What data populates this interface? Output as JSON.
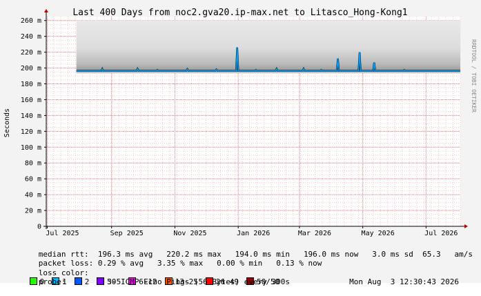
{
  "chart_data": {
    "type": "area",
    "title": "Last 400 Days from noc2.gva20.ip-max.net to Litasco_Hong-Kong1",
    "ylabel": "Seconds",
    "side_label": "RRDTOOL / TOBI OETIKER",
    "ylim": [
      0,
      0.265
    ],
    "y_ticks": [
      {
        "value": 0,
        "label": "0"
      },
      {
        "value": 0.02,
        "label": "20 m"
      },
      {
        "value": 0.04,
        "label": "40 m"
      },
      {
        "value": 0.06,
        "label": "60 m"
      },
      {
        "value": 0.08,
        "label": "80 m"
      },
      {
        "value": 0.1,
        "label": "100 m"
      },
      {
        "value": 0.12,
        "label": "120 m"
      },
      {
        "value": 0.14,
        "label": "140 m"
      },
      {
        "value": 0.16,
        "label": "160 m"
      },
      {
        "value": 0.18,
        "label": "180 m"
      },
      {
        "value": 0.2,
        "label": "200 m"
      },
      {
        "value": 0.22,
        "label": "220 m"
      },
      {
        "value": 0.24,
        "label": "240 m"
      },
      {
        "value": 0.26,
        "label": "260 m"
      }
    ],
    "x_range": [
      "2025-06-30",
      "2026-08-03"
    ],
    "data_start": "2025-07-29",
    "x_ticks": [
      {
        "date": "2025-07-01",
        "label": "Jul 2025"
      },
      {
        "date": "2025-09-01",
        "label": "Sep 2025"
      },
      {
        "date": "2025-11-01",
        "label": "Nov 2025"
      },
      {
        "date": "2026-01-01",
        "label": "Jan 2026"
      },
      {
        "date": "2026-03-01",
        "label": "Mar 2026"
      },
      {
        "date": "2026-05-01",
        "label": "May 2026"
      },
      {
        "date": "2026-07-01",
        "label": "Jul 2026"
      }
    ],
    "smoke_upper": 0.26,
    "median_baseline": 0.1963,
    "median_spikes": [
      {
        "date": "2025-08-23",
        "value": 0.199
      },
      {
        "date": "2025-09-26",
        "value": 0.199
      },
      {
        "date": "2025-10-15",
        "value": 0.1975
      },
      {
        "date": "2025-11-13",
        "value": 0.1985
      },
      {
        "date": "2025-12-11",
        "value": 0.198
      },
      {
        "date": "2025-12-31",
        "value": 0.226
      },
      {
        "date": "2026-01-18",
        "value": 0.1975
      },
      {
        "date": "2026-02-07",
        "value": 0.199
      },
      {
        "date": "2026-03-05",
        "value": 0.199
      },
      {
        "date": "2026-03-22",
        "value": 0.1975
      },
      {
        "date": "2026-04-07",
        "value": 0.212
      },
      {
        "date": "2026-04-28",
        "value": 0.22
      },
      {
        "date": "2026-05-12",
        "value": 0.207
      },
      {
        "date": "2026-06-10",
        "value": 0.1975
      }
    ],
    "colors": {
      "background": "#f3f3f3",
      "canvas": "#ffffff",
      "median": "#00a0ff",
      "median_outline": "#000000",
      "grid_minor": "#f0c8c8",
      "grid_major": "#e08080",
      "axis_arrow": "#c00000"
    }
  },
  "legend": {
    "median_rtt": {
      "label": "median rtt:",
      "avg": "196.3 ms avg",
      "max": "220.2 ms max",
      "min": "194.0 ms min",
      "now": "196.0 ms now",
      "sd": "3.0 ms sd",
      "am": "65.3   am/s"
    },
    "packet_loss": {
      "label": "packet loss:",
      "avg": "0.29 % avg",
      "max": "3.35 % max",
      "min": "0.00 % min",
      "now": "0.13 % now"
    },
    "loss_color": {
      "label": "loss color:",
      "items": [
        {
          "label": "0",
          "color": "#26ff00"
        },
        {
          "label": "1",
          "color": "#00b8ff"
        },
        {
          "label": "2",
          "color": "#0059ff"
        },
        {
          "label": "3-5",
          "color": "#7e00ff"
        },
        {
          "label": "6-12",
          "color": "#ff00ff"
        },
        {
          "label": "13-25",
          "color": "#ff5500"
        },
        {
          "label": "26-49",
          "color": "#ff0000"
        },
        {
          "label": "50/50",
          "color": "#a10000"
        }
      ]
    },
    "probe": {
      "label": "probe:",
      "text": "50 ICMP Echo Pings (56 Bytes) every 300s",
      "timestamp": "Mon Aug  3 12:30:43 2026"
    }
  }
}
